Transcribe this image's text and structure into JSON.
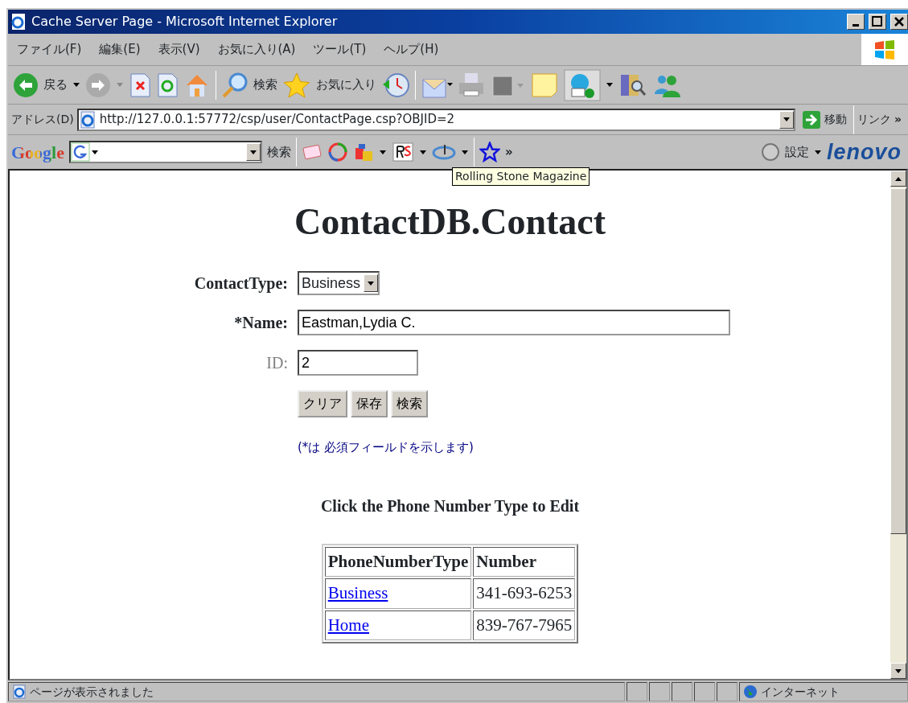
{
  "window": {
    "title": "Cache Server Page - Microsoft Internet Explorer"
  },
  "menu": [
    {
      "label": "ファイル(F)"
    },
    {
      "label": "編集(E)"
    },
    {
      "label": "表示(V)"
    },
    {
      "label": "お気に入り(A)"
    },
    {
      "label": "ツール(T)"
    },
    {
      "label": "ヘルプ(H)"
    }
  ],
  "toolbar": {
    "back_label": "戻る",
    "search_label": "検索",
    "favorites_label": "お気に入り"
  },
  "address": {
    "label": "アドレス(D)",
    "url": "http://127.0.0.1:57772/csp/user/ContactPage.csp?OBJID=2",
    "go_label": "移動",
    "links_label": "リンク",
    "chevron": "»"
  },
  "google_bar": {
    "logo": "Google",
    "search_label": "検索",
    "chevron": "»",
    "settings_label": "設定",
    "brand": "lenovo"
  },
  "tooltip": "Rolling Stone Magazine",
  "page": {
    "heading": "ContactDB.Contact",
    "fields": [
      {
        "kind": "select",
        "label": "ContactType:",
        "value": "Business"
      },
      {
        "kind": "text",
        "label": "*Name:",
        "value": "Eastman,Lydia C."
      },
      {
        "kind": "readonly",
        "label": "ID:",
        "value": "2"
      }
    ],
    "buttons": [
      "クリア",
      "保存",
      "検索"
    ],
    "note": "(*は 必須フィールドを示します)",
    "table_caption": "Click the Phone Number Type to Edit",
    "table": {
      "columns": [
        "PhoneNumberType",
        "Number"
      ],
      "rows": [
        {
          "type": "Business",
          "number": "341-693-6253"
        },
        {
          "type": "Home",
          "number": "839-767-7965"
        }
      ]
    }
  },
  "status_bar": {
    "message": "ページが表示されました",
    "zone": "インターネット"
  }
}
